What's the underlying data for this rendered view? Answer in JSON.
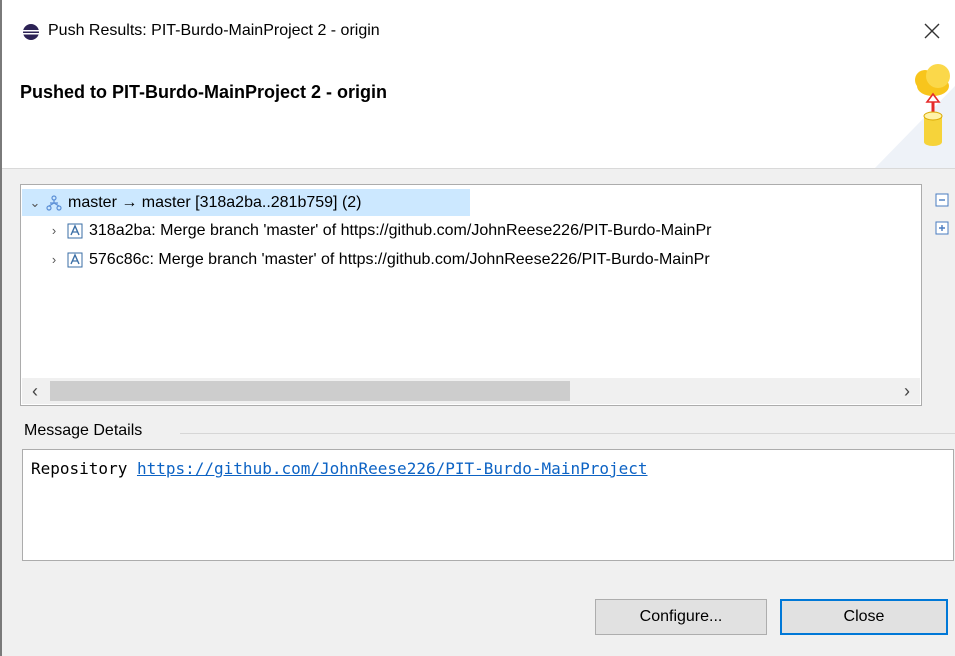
{
  "window": {
    "title": "Push Results: PIT-Burdo-MainProject 2 - origin"
  },
  "header": {
    "title": "Pushed to PIT-Burdo-MainProject 2 - origin",
    "icon": "cloud-upload-database-icon"
  },
  "tree": {
    "root": {
      "label": "master → master [318a2ba..281b759] (2)",
      "icon": "branch-icon",
      "expanded": true
    },
    "children": [
      {
        "label": "318a2ba: Merge branch 'master' of https://github.com/JohnReese226/PIT-Burdo-MainPr",
        "icon": "commit-icon"
      },
      {
        "label": "576c86c: Merge branch 'master' of https://github.com/JohnReese226/PIT-Burdo-MainPr",
        "icon": "commit-icon"
      }
    ],
    "side_buttons": [
      "collapse-all-icon",
      "expand-all-icon"
    ]
  },
  "details": {
    "label": "Message Details",
    "prefix": "Repository",
    "link": "https://github.com/JohnReese226/PIT-Burdo-MainProject"
  },
  "buttons": {
    "configure": "Configure...",
    "close": "Close"
  },
  "colors": {
    "selection": "#cce8ff",
    "link": "#0d63c4",
    "default_button_border": "#0078d7"
  }
}
